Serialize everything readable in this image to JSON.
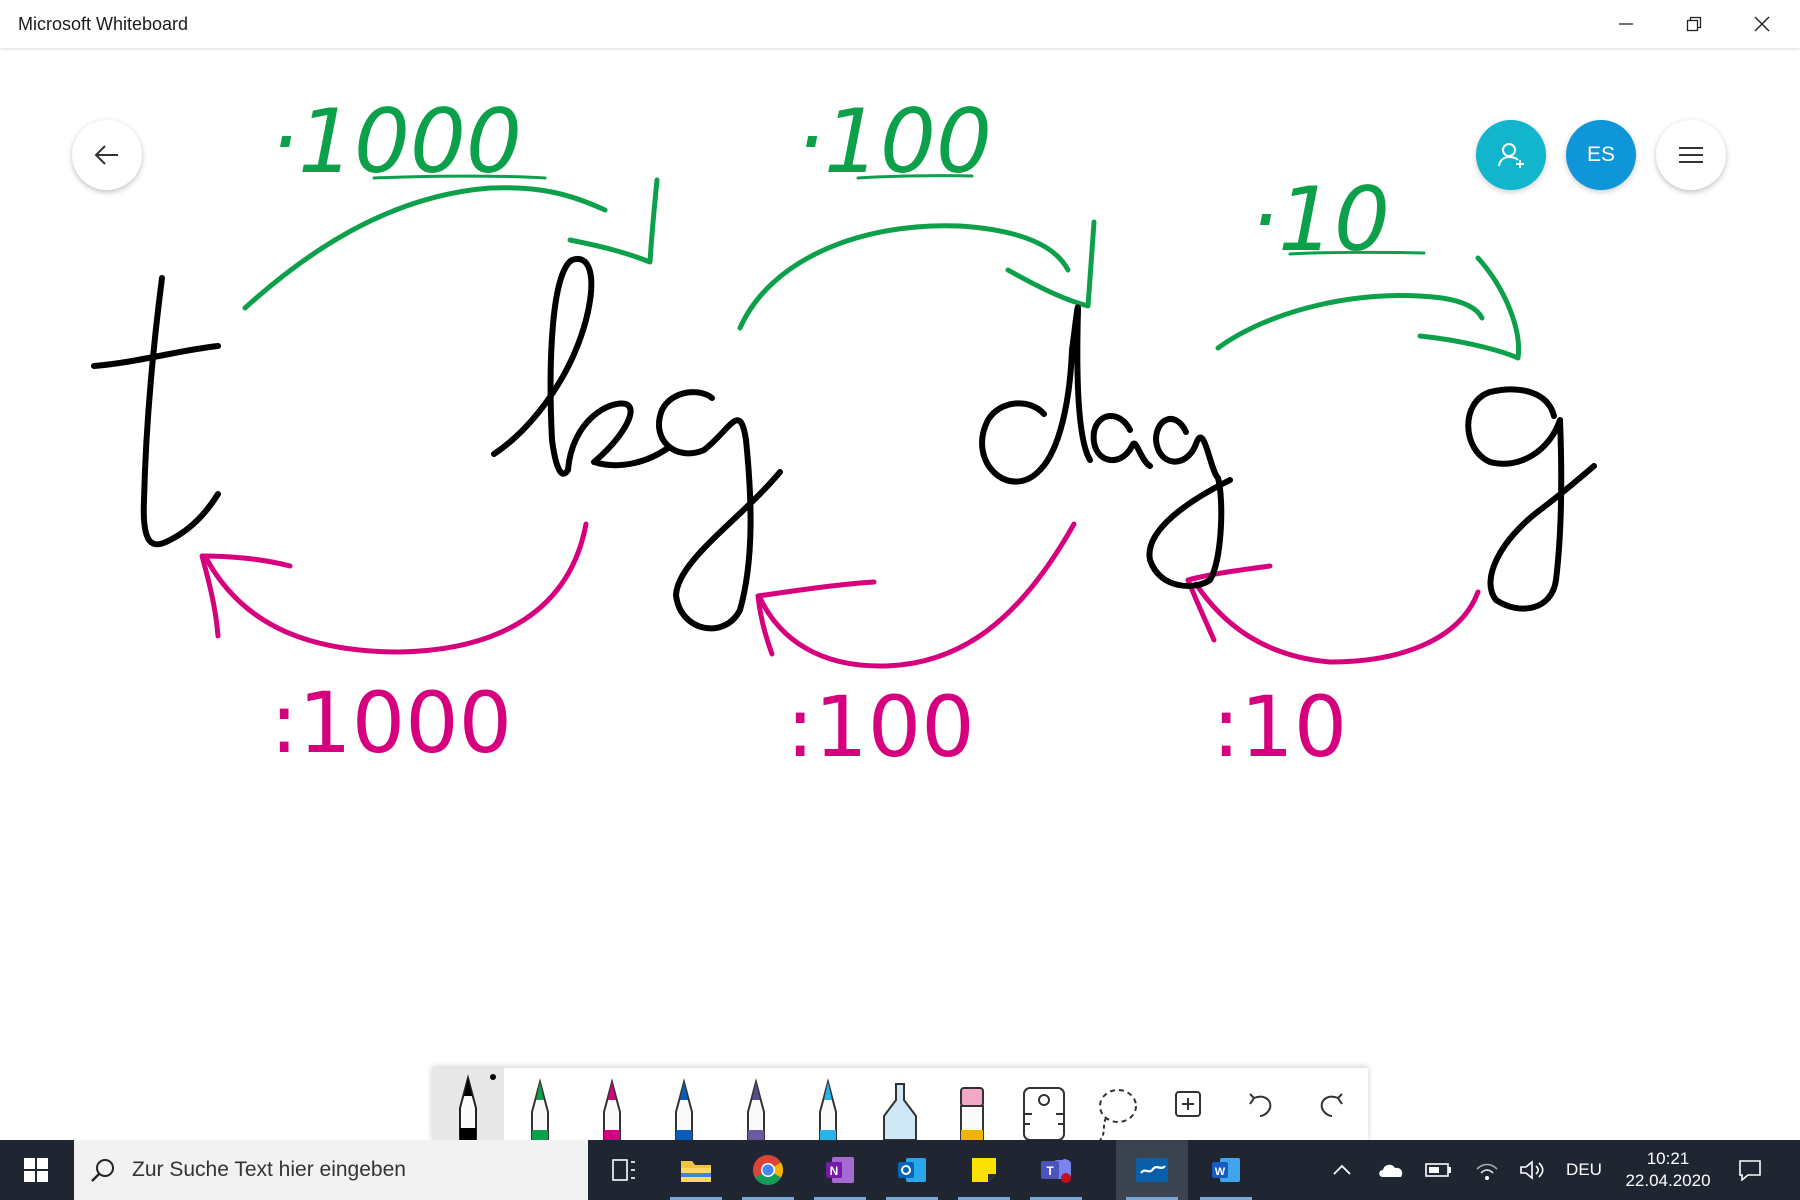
{
  "window": {
    "title": "Microsoft Whiteboard"
  },
  "colors": {
    "ink_black": "#000000",
    "ink_green": "#0da04a",
    "ink_magenta": "#d6007e",
    "share": "#11b5cc",
    "avatar": "#0f96d8"
  },
  "header": {
    "avatar_initials": "ES"
  },
  "board": {
    "units": {
      "t": "t",
      "kg": "kg",
      "dag": "dag",
      "g": "g"
    },
    "multiply": {
      "t_kg": "·1000",
      "kg_dag": "·100",
      "dag_g": "·10"
    },
    "divide": {
      "kg_t": ":1000",
      "dag_kg": ":100",
      "g_dag": ":10"
    }
  },
  "toolbar": {
    "tools": [
      "black-pen",
      "green-pen",
      "magenta-pen",
      "blue-pen",
      "galaxy-pen",
      "light-blue-pen",
      "highlighter",
      "eraser",
      "ruler",
      "lasso",
      "add",
      "undo",
      "redo"
    ]
  },
  "taskbar": {
    "search_placeholder": "Zur Suche Text hier eingeben",
    "language": "DEU",
    "time": "10:21",
    "date": "22.04.2020"
  }
}
